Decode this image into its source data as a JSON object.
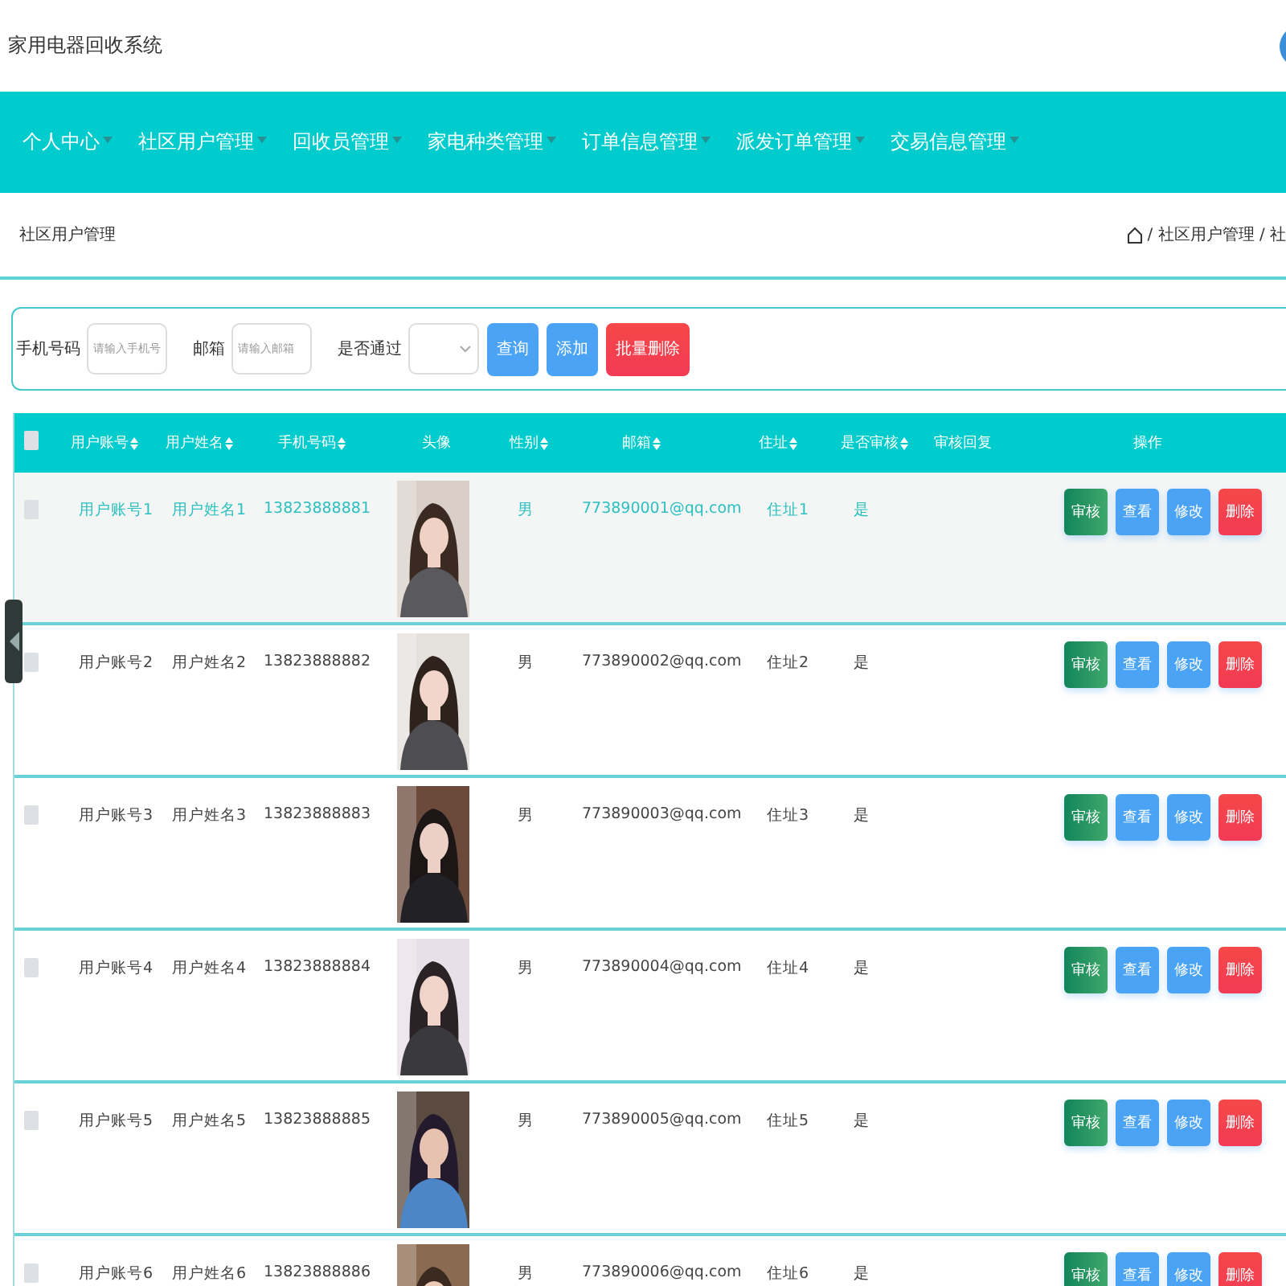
{
  "header": {
    "title": "家用电器回收系统"
  },
  "nav": [
    {
      "label": "个人中心"
    },
    {
      "label": "社区用户管理"
    },
    {
      "label": "回收员管理"
    },
    {
      "label": "家电种类管理"
    },
    {
      "label": "订单信息管理"
    },
    {
      "label": "派发订单管理"
    },
    {
      "label": "交易信息管理"
    }
  ],
  "page_title": "社区用户管理",
  "breadcrumb": "/ 社区用户管理 / 社",
  "search": {
    "fields": [
      {
        "label": "手机号码",
        "placeholder": "请输入手机号",
        "kind": "input"
      },
      {
        "label": "邮箱",
        "placeholder": "请输入邮箱",
        "kind": "input"
      },
      {
        "label": "是否通过",
        "kind": "select"
      }
    ],
    "buttons": [
      {
        "label": "查询",
        "kind": "primary"
      },
      {
        "label": "添加",
        "kind": "primary"
      },
      {
        "label": "批量删除",
        "kind": "danger"
      }
    ]
  },
  "table": {
    "all_checked": false,
    "columns": [
      {
        "label": "用户账号",
        "sortable": true
      },
      {
        "label": "用户姓名",
        "sortable": true
      },
      {
        "label": "手机号码",
        "sortable": true
      },
      {
        "label": "头像",
        "sortable": false
      },
      {
        "label": "性别",
        "sortable": true
      },
      {
        "label": "邮箱",
        "sortable": true
      },
      {
        "label": "住址",
        "sortable": true
      },
      {
        "label": "是否审核",
        "sortable": true
      },
      {
        "label": "审核回复",
        "sortable": false
      },
      {
        "label": "操作",
        "sortable": false
      }
    ],
    "rows": [
      {
        "checked": false,
        "account": "用户账号1",
        "name": "用户姓名1",
        "phone": "13823888881",
        "gender": "男",
        "email": "773890001@qq.com",
        "address": "住址1",
        "reviewed": "是",
        "hovered": true,
        "actions": [
          {
            "label": "审核",
            "kind": "review"
          },
          {
            "label": "查看",
            "kind": "view"
          },
          {
            "label": "修改",
            "kind": "edit"
          },
          {
            "label": "删除",
            "kind": "delete"
          }
        ]
      },
      {
        "checked": false,
        "account": "用户账号2",
        "name": "用户姓名2",
        "phone": "13823888882",
        "gender": "男",
        "email": "773890002@qq.com",
        "address": "住址2",
        "reviewed": "是",
        "hovered": false,
        "actions": [
          {
            "label": "审核",
            "kind": "review"
          },
          {
            "label": "查看",
            "kind": "view"
          },
          {
            "label": "修改",
            "kind": "edit"
          },
          {
            "label": "删除",
            "kind": "delete"
          }
        ]
      },
      {
        "checked": false,
        "account": "用户账号3",
        "name": "用户姓名3",
        "phone": "13823888883",
        "gender": "男",
        "email": "773890003@qq.com",
        "address": "住址3",
        "reviewed": "是",
        "hovered": false,
        "actions": [
          {
            "label": "审核",
            "kind": "review"
          },
          {
            "label": "查看",
            "kind": "view"
          },
          {
            "label": "修改",
            "kind": "edit"
          },
          {
            "label": "删除",
            "kind": "delete"
          }
        ]
      },
      {
        "checked": false,
        "account": "用户账号4",
        "name": "用户姓名4",
        "phone": "13823888884",
        "gender": "男",
        "email": "773890004@qq.com",
        "address": "住址4",
        "reviewed": "是",
        "hovered": false,
        "actions": [
          {
            "label": "审核",
            "kind": "review"
          },
          {
            "label": "查看",
            "kind": "view"
          },
          {
            "label": "修改",
            "kind": "edit"
          },
          {
            "label": "删除",
            "kind": "delete"
          }
        ]
      },
      {
        "checked": false,
        "account": "用户账号5",
        "name": "用户姓名5",
        "phone": "13823888885",
        "gender": "男",
        "email": "773890005@qq.com",
        "address": "住址5",
        "reviewed": "是",
        "hovered": false,
        "actions": [
          {
            "label": "审核",
            "kind": "review"
          },
          {
            "label": "查看",
            "kind": "view"
          },
          {
            "label": "修改",
            "kind": "edit"
          },
          {
            "label": "删除",
            "kind": "delete"
          }
        ]
      },
      {
        "checked": false,
        "account": "用户账号6",
        "name": "用户姓名6",
        "phone": "13823888886",
        "gender": "男",
        "email": "773890006@qq.com",
        "address": "住址6",
        "reviewed": "是",
        "hovered": false,
        "actions": [
          {
            "label": "审核",
            "kind": "review"
          },
          {
            "label": "查看",
            "kind": "view"
          },
          {
            "label": "修改",
            "kind": "edit"
          },
          {
            "label": "删除",
            "kind": "delete"
          }
        ]
      }
    ]
  }
}
